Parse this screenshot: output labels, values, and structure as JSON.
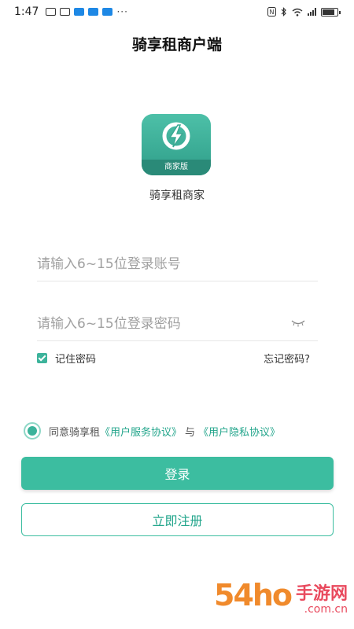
{
  "status_bar": {
    "time": "1:47",
    "more": "···"
  },
  "title": "骑享租商户端",
  "logo": {
    "badge": "商家版",
    "app_name": "骑享租商家"
  },
  "account": {
    "placeholder": "请输入6~15位登录账号"
  },
  "password": {
    "placeholder": "请输入6~15位登录密码"
  },
  "remember_label": "记住密码",
  "forgot_label": "忘记密码?",
  "agreement": {
    "prefix": "同意骑享租",
    "service": "《用户服务协议》",
    "and": "与",
    "privacy": "《用户隐私协议》"
  },
  "login_label": "登录",
  "register_label": "立即注册",
  "watermark": {
    "num": "54ho",
    "cn": "手游网",
    "url": ".com.cn"
  },
  "colors": {
    "accent": "#3cbda0",
    "link": "#22a58b"
  }
}
